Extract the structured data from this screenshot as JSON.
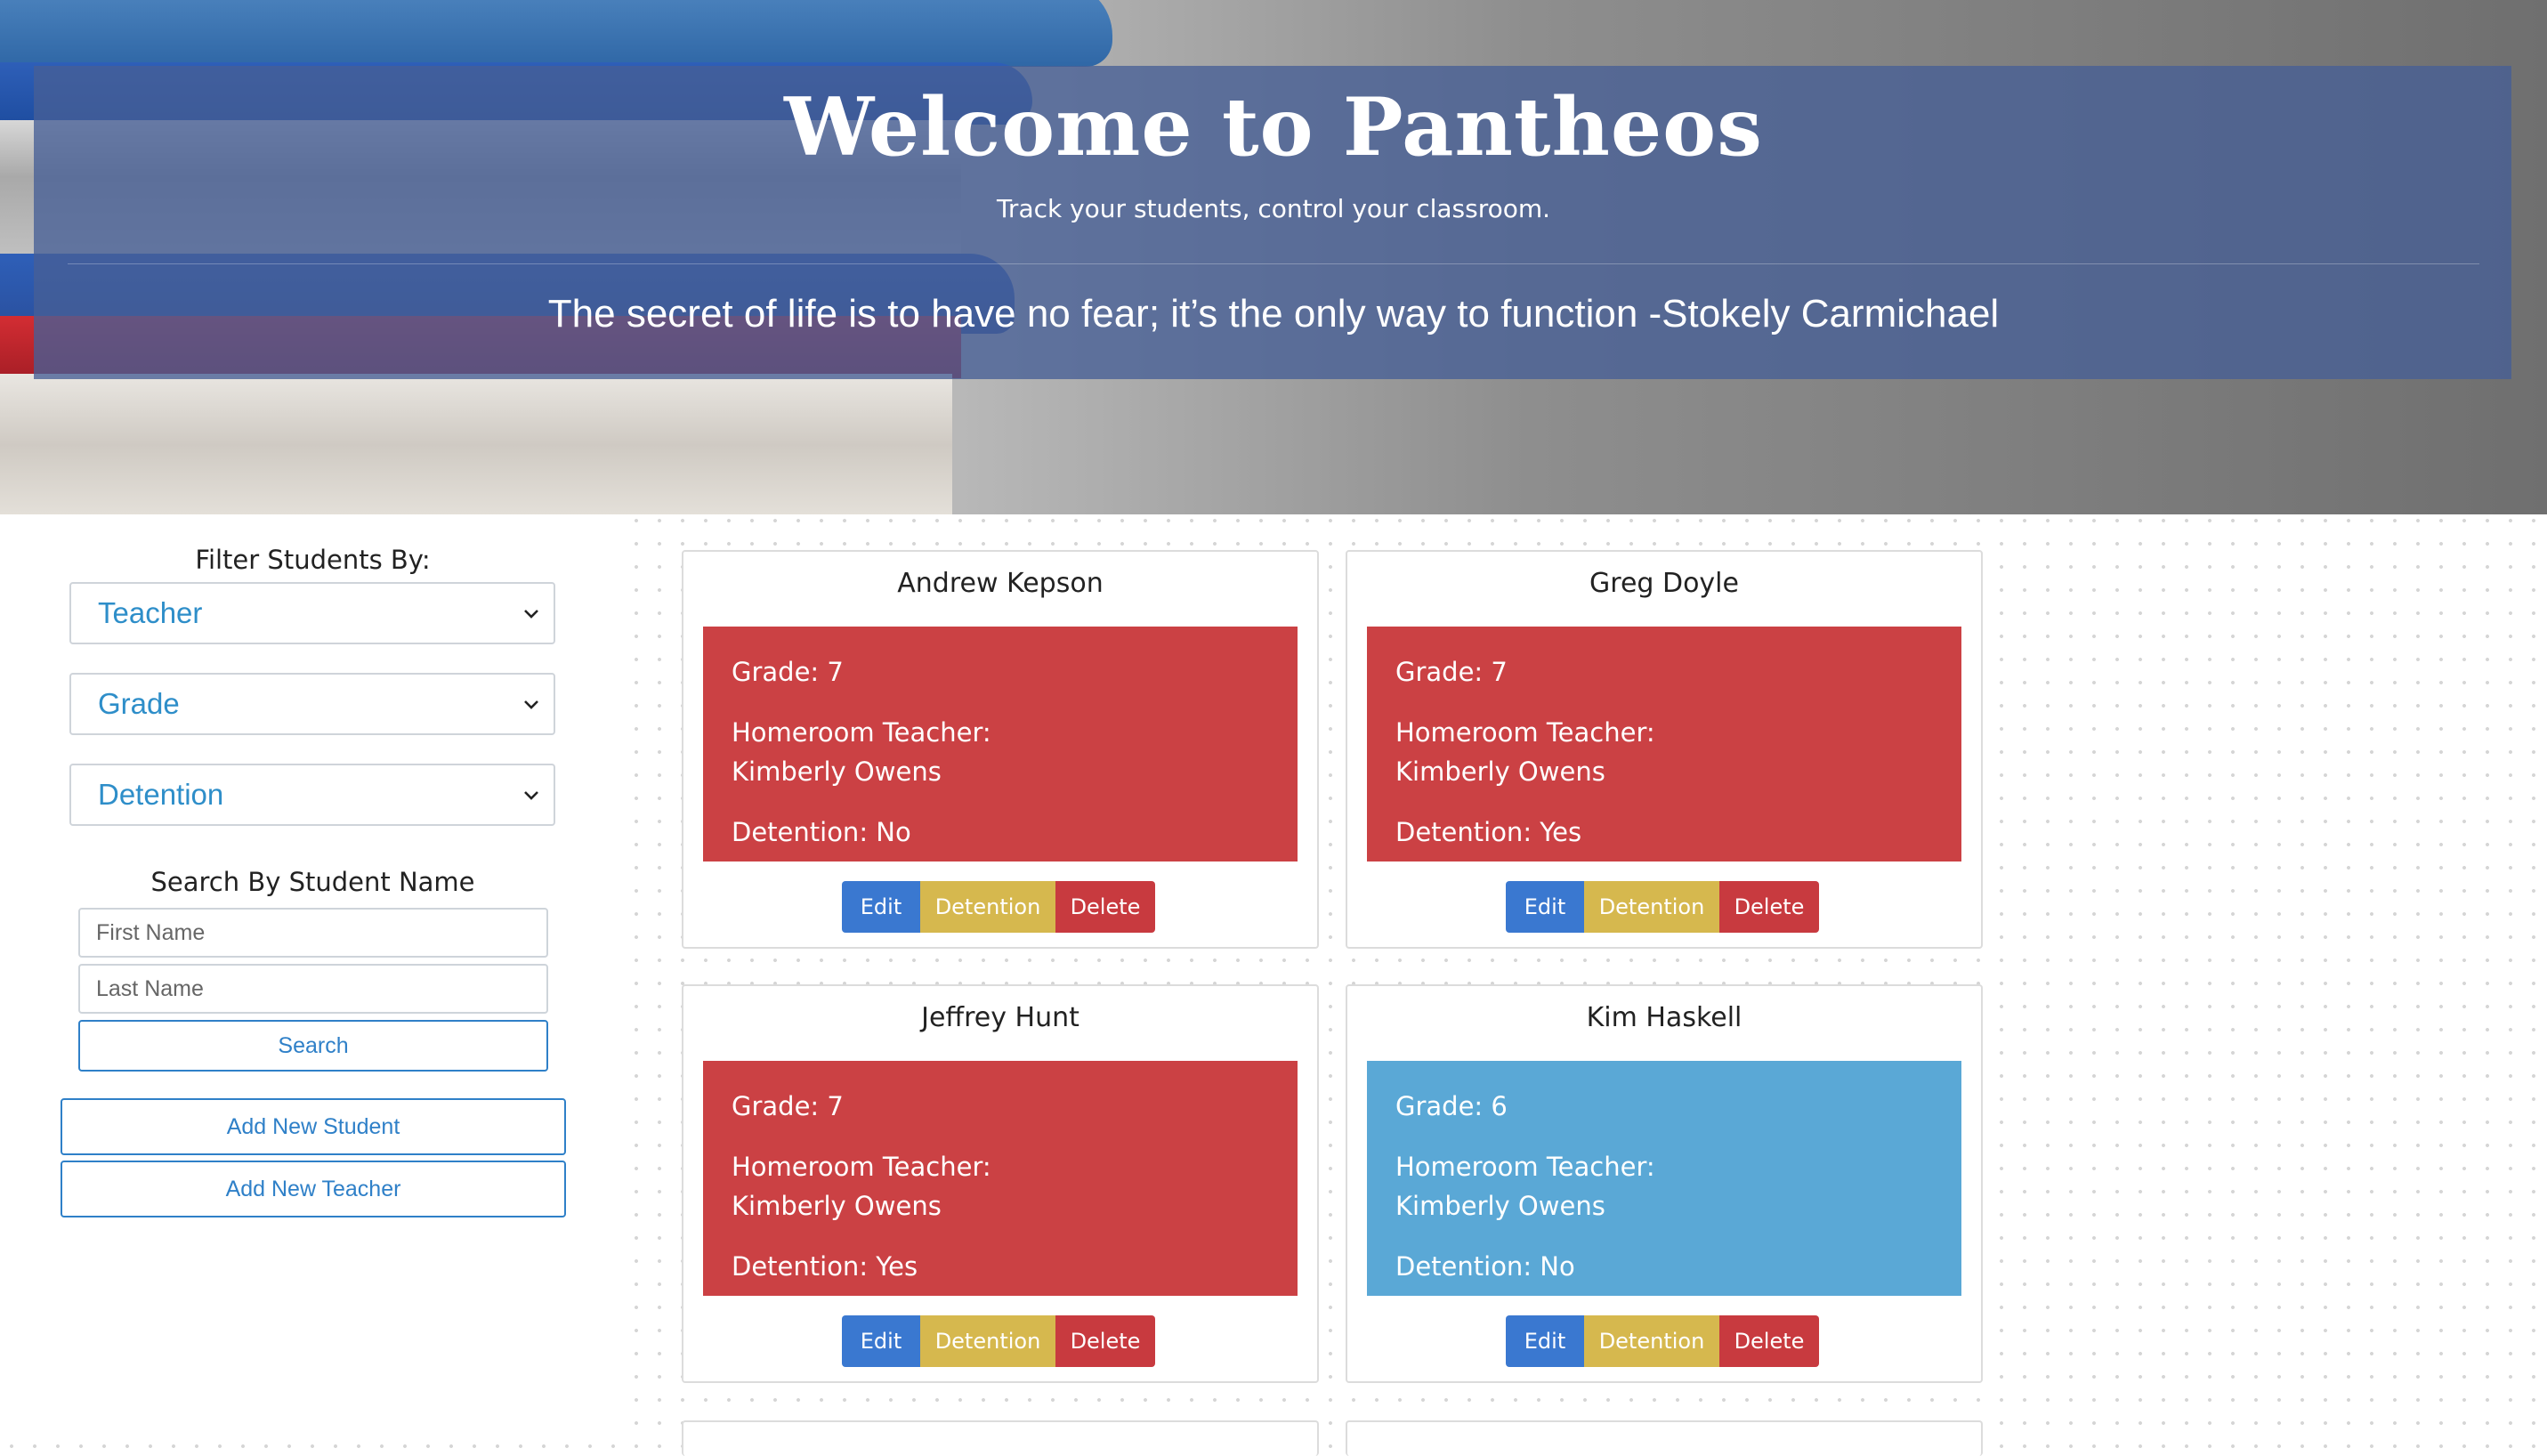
{
  "hero": {
    "title": "Welcome to Pantheos",
    "subtitle": "Track your students, control your classroom.",
    "quote": "The secret of life is to have no fear; it’s the only way to function -Stokely Carmichael"
  },
  "sidebar": {
    "filter_title": "Filter Students By:",
    "filters": [
      {
        "selected": "Teacher"
      },
      {
        "selected": "Grade"
      },
      {
        "selected": "Detention"
      }
    ],
    "search_title": "Search By Student Name",
    "first_name_placeholder": "First Name",
    "last_name_placeholder": "Last Name",
    "search_label": "Search",
    "add_student_label": "Add New Student",
    "add_teacher_label": "Add New Teacher"
  },
  "students": [
    {
      "name": "Andrew Kepson",
      "grade": "Grade: 7",
      "homeroom_label": "Homeroom Teacher:",
      "teacher": "Kimberly Owens",
      "detention": "Detention: No"
    },
    {
      "name": "Greg Doyle",
      "grade": "Grade: 7",
      "homeroom_label": "Homeroom Teacher:",
      "teacher": "Kimberly Owens",
      "detention": "Detention: Yes"
    },
    {
      "name": "Jeffrey Hunt",
      "grade": "Grade: 7",
      "homeroom_label": "Homeroom Teacher:",
      "teacher": "Kimberly Owens",
      "detention": "Detention: Yes"
    },
    {
      "name": "Kim Haskell",
      "grade": "Grade: 6",
      "homeroom_label": "Homeroom Teacher:",
      "teacher": "Kimberly Owens",
      "detention": "Detention: No"
    }
  ],
  "card_actions": {
    "edit": "Edit",
    "detention": "Detention",
    "delete": "Delete"
  },
  "colors": {
    "grade7": "#cb4144",
    "grade6": "#5aa8d6",
    "edit": "#3a78d0",
    "detention": "#d6b84e",
    "delete": "#c83a3f",
    "accent": "#2f80c8"
  }
}
